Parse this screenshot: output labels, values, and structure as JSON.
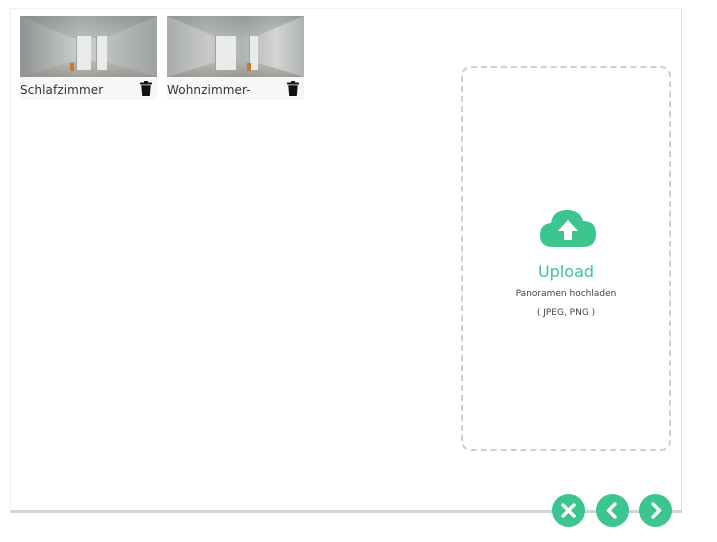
{
  "thumbnails": [
    {
      "label": "Schlafzimmer",
      "icon": "trash-icon"
    },
    {
      "label": "Wohnzimmer-",
      "icon": "trash-icon"
    }
  ],
  "upload": {
    "icon": "cloud-upload-icon",
    "title": "Upload",
    "subtitle": "Panoramen hochladen",
    "formats": "( JPEG, PNG )"
  },
  "actions": {
    "close_icon": "close-icon",
    "prev_icon": "chevron-left-icon",
    "next_icon": "chevron-right-icon"
  },
  "colors": {
    "accent": "#3cc58f",
    "dropzone_border": "#cfcfcf",
    "text": "#333333"
  }
}
